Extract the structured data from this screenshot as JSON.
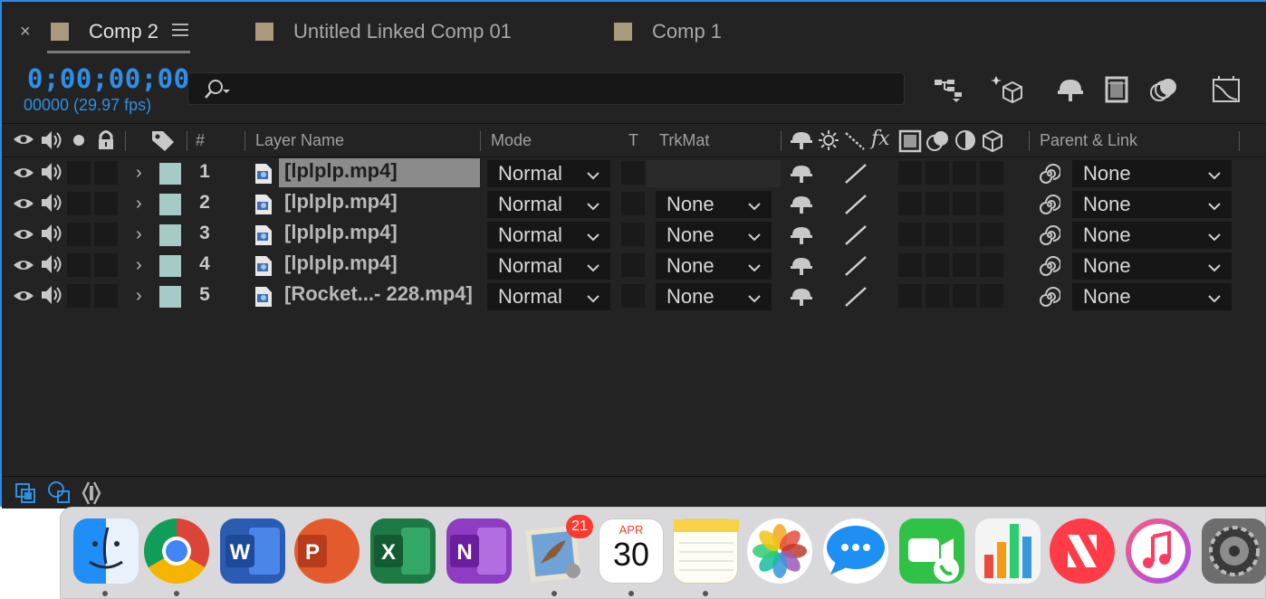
{
  "tabs": [
    {
      "label": "Comp 2",
      "active": true
    },
    {
      "label": "Untitled Linked Comp 01",
      "active": false
    },
    {
      "label": "Comp 1",
      "active": false
    }
  ],
  "timecode": "0;00;00;00",
  "frame_info": "00000 (29.97 fps)",
  "search": {
    "placeholder": "",
    "value": ""
  },
  "columns": {
    "hash": "#",
    "layer_name": "Layer Name",
    "mode": "Mode",
    "t": "T",
    "trkmat": "TrkMat",
    "fx": "fx",
    "parent_link": "Parent & Link"
  },
  "layers": [
    {
      "num": "1",
      "name": "[lplplp.mp4]",
      "mode": "Normal",
      "trkmat": "",
      "parent": "None",
      "selected": true
    },
    {
      "num": "2",
      "name": "[lplplp.mp4]",
      "mode": "Normal",
      "trkmat": "None",
      "parent": "None",
      "selected": false
    },
    {
      "num": "3",
      "name": "[lplplp.mp4]",
      "mode": "Normal",
      "trkmat": "None",
      "parent": "None",
      "selected": false
    },
    {
      "num": "4",
      "name": "[lplplp.mp4]",
      "mode": "Normal",
      "trkmat": "None",
      "parent": "None",
      "selected": false
    },
    {
      "num": "5",
      "name": "[Rocket...- 228.mp4]",
      "mode": "Normal",
      "trkmat": "None",
      "parent": "None",
      "selected": false
    }
  ],
  "dock": {
    "mail_badge": "21",
    "calendar_month": "APR",
    "calendar_day": "30",
    "apps": [
      "finder",
      "chrome",
      "word",
      "powerpoint",
      "excel",
      "onenote",
      "mail",
      "calendar",
      "notes",
      "photos",
      "messages",
      "facetime",
      "numbers",
      "news",
      "music",
      "system-preferences"
    ]
  },
  "colors": {
    "accent": "#2f8fe6",
    "panel_bg": "#232323",
    "layer_label": "#a6cac6",
    "comp_swatch": "#a99a7b"
  }
}
